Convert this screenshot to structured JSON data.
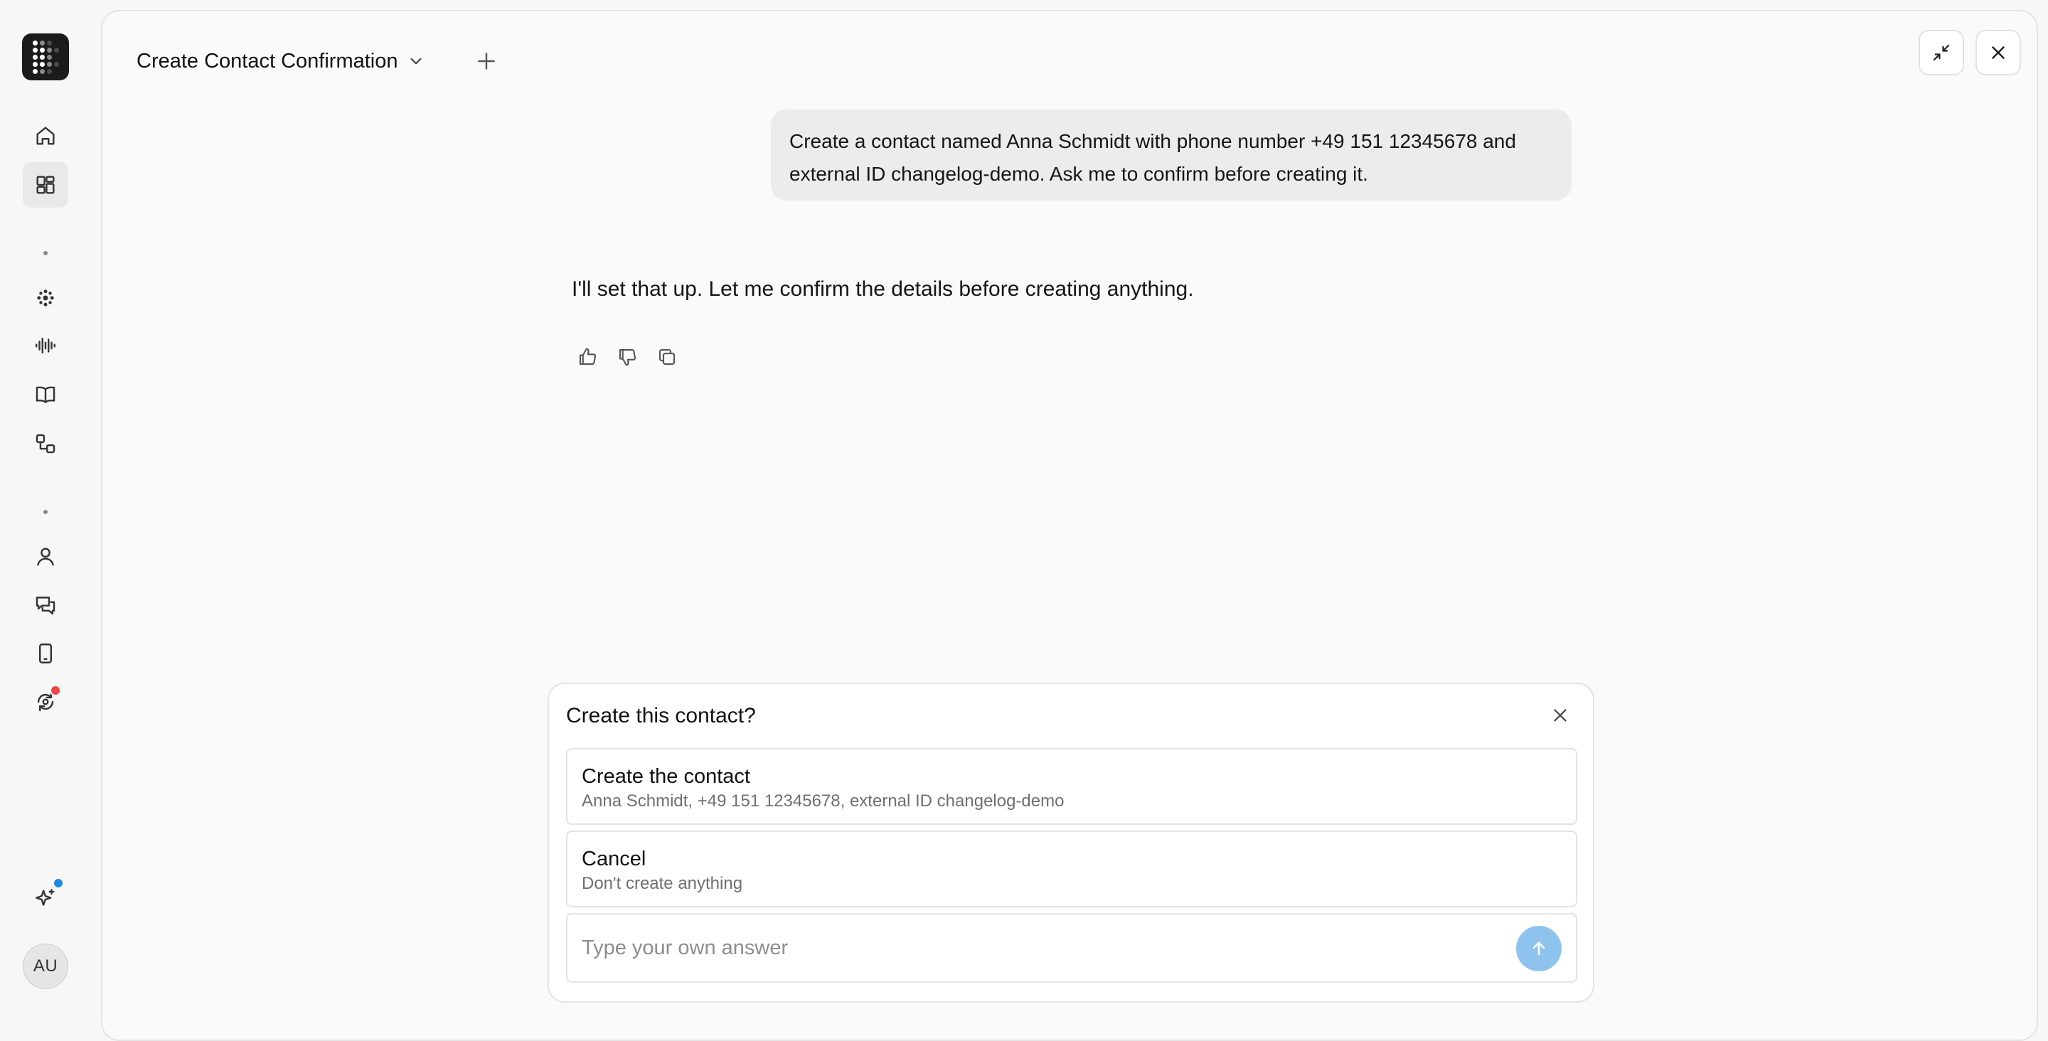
{
  "sidebar": {
    "logo": "app-logo",
    "items": [
      {
        "name": "home-icon"
      },
      {
        "name": "dashboard-icon",
        "active": true
      },
      {
        "name": "agent-icon"
      },
      {
        "name": "voice-icon"
      },
      {
        "name": "knowledge-book-icon"
      },
      {
        "name": "workflow-icon"
      },
      {
        "name": "contacts-icon"
      },
      {
        "name": "conversations-icon"
      },
      {
        "name": "phone-icon"
      },
      {
        "name": "sync-icon",
        "badge_color": "#ef4444"
      },
      {
        "name": "ai-sparkle-icon",
        "badge_color": "#1e88e5"
      }
    ],
    "avatar_initials": "AU"
  },
  "header": {
    "title": "Create Contact Confirmation"
  },
  "conversation": {
    "user_message": "Create a contact named Anna Schmidt with phone number +49 151 12345678 and external ID changelog-demo. Ask me to confirm before creating it.",
    "assistant_message": "I'll set that up. Let me confirm the details before creating anything."
  },
  "confirm_card": {
    "title": "Create this contact?",
    "options": [
      {
        "label": "Create the contact",
        "description": "Anna Schmidt, +49 151 12345678, external ID changelog-demo"
      },
      {
        "label": "Cancel",
        "description": "Don't create anything"
      }
    ],
    "answer_placeholder": "Type your own answer"
  },
  "colors": {
    "send_button": "#8ec3ee",
    "sync_badge": "#ef4444",
    "sparkle_badge": "#1e88e5"
  }
}
